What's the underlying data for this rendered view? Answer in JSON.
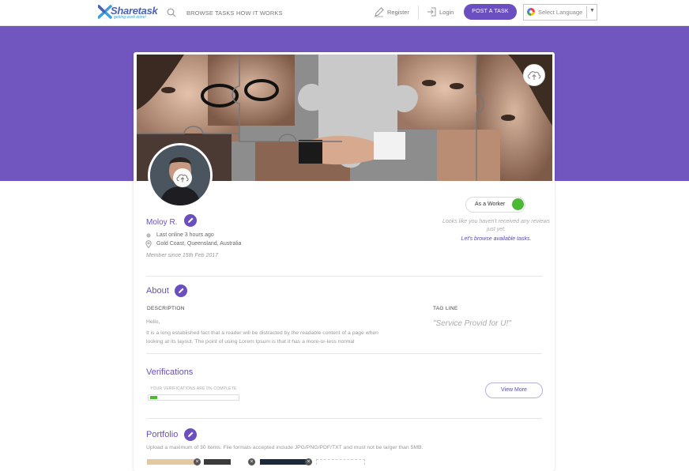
{
  "header": {
    "logo_text": "Sharetask",
    "logo_tagline": "getting work done!",
    "nav": [
      "BROWSE TASKS",
      "HOW IT WORKS"
    ],
    "register_label": "Register",
    "login_label": "Login",
    "post_task_label": "POST A TASK",
    "language_label": "Select Language"
  },
  "profile": {
    "name": "Moloy R.",
    "last_online": "Last online 3 hours ago",
    "location": "Gold Coast, Queensland, Australia",
    "member_since": "Member since 15th Feb 2017",
    "role_label": "As a Worker",
    "role_on": true,
    "no_reviews_text": "Looks like you haven't received any reviews just yet.",
    "browse_link": "Let's browse available tasks."
  },
  "about": {
    "title": "About",
    "description_label": "DESCRIPTION",
    "greeting": "Hello,",
    "description_line1": "It is a long established fact that a reader will be distracted by the readable content of a page when",
    "description_line2": "looking at its layout. The point of using Lorem Ipsum is that it has a more-or-less normal",
    "tagline_label": "TAG LINE",
    "tagline": "\"Service Provid for U!\""
  },
  "verifications": {
    "title": "Verifications",
    "status": "YOUR VERIFICATIONS ARE 0% COMPLETE",
    "progress_fraction": 0.08,
    "view_more_label": "View More"
  },
  "portfolio": {
    "title": "Portfolio",
    "note": "Upload a maximum of 30 items. File formats accepted include JPG/PNG/PDF/TXT and must not be larger than 5MB."
  },
  "colors": {
    "brand_purple": "#7156c0",
    "accent": "#6b4fc0",
    "online_green": "#4db833"
  }
}
